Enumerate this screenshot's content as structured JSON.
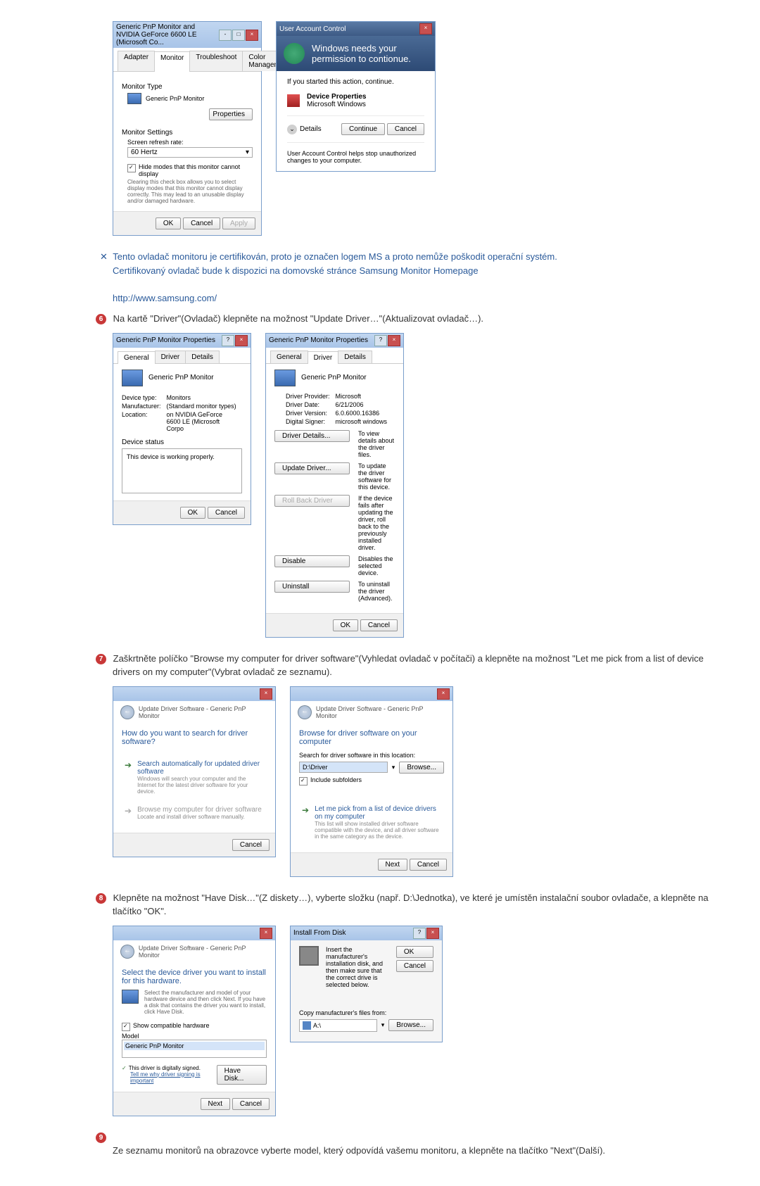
{
  "dlg1": {
    "title": "Generic PnP Monitor and NVIDIA GeForce 6600 LE (Microsoft Co...",
    "tabs": [
      "Adapter",
      "Monitor",
      "Troubleshoot",
      "Color Management"
    ],
    "monitorType": "Monitor Type",
    "monitorName": "Generic PnP Monitor",
    "propertiesBtn": "Properties",
    "monitorSettings": "Monitor Settings",
    "refreshLabel": "Screen refresh rate:",
    "refreshValue": "60 Hertz",
    "hideModes": "Hide modes that this monitor cannot display",
    "hideModesDesc": "Clearing this check box allows you to select display modes that this monitor cannot display correctly. This may lead to an unusable display and/or damaged hardware.",
    "ok": "OK",
    "cancel": "Cancel",
    "apply": "Apply"
  },
  "uac": {
    "title": "User Account Control",
    "heading": "Windows needs your permission to contionue.",
    "startedAction": "If you started this action, continue.",
    "deviceProps": "Device Properties",
    "msWindows": "Microsoft Windows",
    "details": "Details",
    "continue": "Continue",
    "cancel": "Cancel",
    "footer": "User Account Control helps stop unauthorized changes to your computer."
  },
  "note1": {
    "line1": "Tento ovladač monitoru je certifikován, proto je označen logem MS a proto nemůže poškodit operační systém.",
    "line2": "Certifikovaný ovladač bude k dispozici na domovské stránce Samsung Monitor Homepage",
    "link": "http://www.samsung.com/"
  },
  "step6": {
    "text": "Na kartě \"Driver\"(Ovladač) klepněte na možnost \"Update Driver…\"(Aktualizovat ovladač…)."
  },
  "propsDlg": {
    "title": "Generic PnP Monitor Properties",
    "tabs": [
      "General",
      "Driver",
      "Details"
    ],
    "deviceName": "Generic PnP Monitor",
    "deviceType": "Device type:",
    "deviceTypeVal": "Monitors",
    "manufacturer": "Manufacturer:",
    "manufacturerVal": "(Standard monitor types)",
    "location": "Location:",
    "locationVal": "on NVIDIA GeForce 6600 LE (Microsoft Corpo",
    "deviceStatus": "Device status",
    "statusText": "This device is working properly.",
    "ok": "OK",
    "cancel": "Cancel"
  },
  "driverDlg": {
    "title": "Generic PnP Monitor Properties",
    "deviceName": "Generic PnP Monitor",
    "provider": "Driver Provider:",
    "providerVal": "Microsoft",
    "date": "Driver Date:",
    "dateVal": "6/21/2006",
    "version": "Driver Version:",
    "versionVal": "6.0.6000.16386",
    "signer": "Digital Signer:",
    "signerVal": "microsoft windows",
    "driverDetails": "Driver Details...",
    "driverDetailsDesc": "To view details about the driver files.",
    "updateDriver": "Update Driver...",
    "updateDriverDesc": "To update the driver software for this device.",
    "rollBack": "Roll Back Driver",
    "rollBackDesc": "If the device fails after updating the driver, roll back to the previously installed driver.",
    "disable": "Disable",
    "disableDesc": "Disables the selected device.",
    "uninstall": "Uninstall",
    "uninstallDesc": "To uninstall the driver (Advanced).",
    "ok": "OK",
    "cancel": "Cancel"
  },
  "step7": {
    "text": "Zaškrtněte políčko \"Browse my computer for driver software\"(Vyhledat ovladač v počítači) a klepněte na možnost \"Let me pick from a list of device drivers on my computer\"(Vybrat ovladač ze seznamu)."
  },
  "wizard1": {
    "breadcrumb": "Update Driver Software - Generic PnP Monitor",
    "heading": "How do you want to search for driver software?",
    "opt1Title": "Search automatically for updated driver software",
    "opt1Sub": "Windows will search your computer and the Internet for the latest driver software for your device.",
    "opt2Title": "Browse my computer for driver software",
    "opt2Sub": "Locate and install driver software manually.",
    "cancel": "Cancel"
  },
  "wizard2": {
    "breadcrumb": "Update Driver Software - Generic PnP Monitor",
    "heading": "Browse for driver software on your computer",
    "searchLabel": "Search for driver software in this location:",
    "path": "D:\\Driver",
    "browse": "Browse...",
    "includeSub": "Include subfolders",
    "optTitle": "Let me pick from a list of device drivers on my computer",
    "optSub": "This list will show installed driver software compatible with the device, and all driver software in the same category as the device.",
    "next": "Next",
    "cancel": "Cancel"
  },
  "step8": {
    "text": "Klepněte na možnost \"Have Disk…\"(Z diskety…), vyberte složku (např. D:\\Jednotka), ve které je umístěn instalační soubor ovladače, a klepněte na tlačítko \"OK\"."
  },
  "wizard3": {
    "breadcrumb": "Update Driver Software - Generic PnP Monitor",
    "heading": "Select the device driver you want to install for this hardware.",
    "instruction": "Select the manufacturer and model of your hardware device and then click Next. If you have a disk that contains the driver you want to install, click Have Disk.",
    "showCompat": "Show compatible hardware",
    "model": "Model",
    "genericPnP": "Generic PnP Monitor",
    "signed": "This driver is digitally signed.",
    "tellMe": "Tell me why driver signing is important",
    "haveDisk": "Have Disk...",
    "next": "Next",
    "cancel": "Cancel"
  },
  "installDisk": {
    "title": "Install From Disk",
    "instruction": "Insert the manufacturer's installation disk, and then make sure that the correct drive is selected below.",
    "ok": "OK",
    "cancel": "Cancel",
    "copyFrom": "Copy manufacturer's files from:",
    "path": "A:\\",
    "browse": "Browse..."
  },
  "step9": {
    "text": "Ze seznamu monitorů na obrazovce vyberte model, který odpovídá vašemu monitoru, a klepněte na tlačítko \"Next\"(Další)."
  }
}
